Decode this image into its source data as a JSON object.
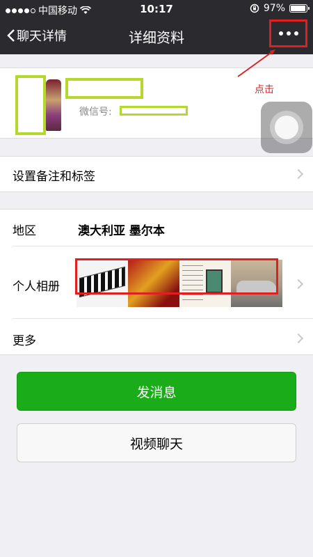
{
  "status_bar": {
    "carrier": "中国移动",
    "time": "10:17",
    "battery_percent": "97%",
    "battery_level": 0.97,
    "signal_dots_filled": 4,
    "signal_dots_total": 5,
    "icons": [
      "signal-dots-icon",
      "wifi-icon",
      "rotation-lock-icon",
      "battery-icon"
    ]
  },
  "nav": {
    "back_label": "聊天详情",
    "title": "详细资料",
    "more_icon": "more-dots-icon"
  },
  "profile": {
    "wechat_id_label": "微信号:"
  },
  "annotation": {
    "text": "点击",
    "color": "#e02020"
  },
  "remark_row": {
    "label": "设置备注和标签"
  },
  "info": {
    "region_label": "地区",
    "region_value": "澳大利亚 墨尔本",
    "album_label": "个人相册",
    "more_label": "更多"
  },
  "buttons": {
    "send_message": "发消息",
    "video_call": "视频聊天"
  },
  "colors": {
    "nav_bg": "#2b2b2f",
    "primary_green": "#1aad19",
    "highlight_red": "#e02020",
    "mask_green": "#b5d82c"
  }
}
